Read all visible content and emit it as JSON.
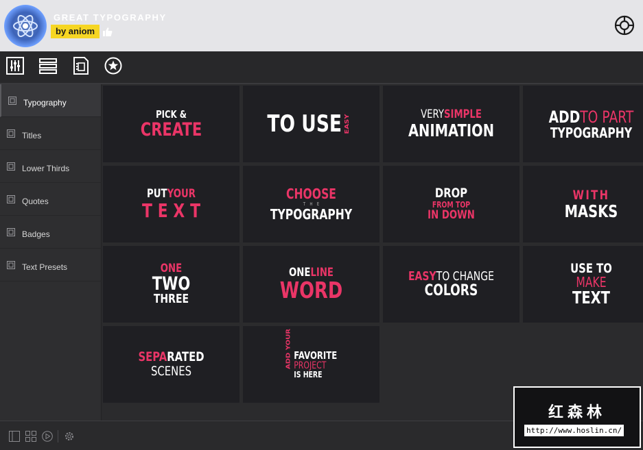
{
  "header": {
    "title": "GREAT TYPOGRAPHY",
    "author": "by aniom",
    "logo_icon": "atom-logo-icon",
    "like_icon": "thumbs-up-icon",
    "help_icon": "lifebuoy-icon"
  },
  "toolbar": {
    "buttons": [
      "sliders-icon",
      "list-icon",
      "film-icon",
      "star-icon"
    ]
  },
  "sidebar": {
    "items": [
      {
        "label": "Typography",
        "active": true
      },
      {
        "label": "Titles"
      },
      {
        "label": "Lower Thirds"
      },
      {
        "label": "Quotes"
      },
      {
        "label": "Badges"
      },
      {
        "label": "Text Presets"
      }
    ]
  },
  "tiles": [
    {
      "l1": "PICK &",
      "l2": "CREATE"
    },
    {
      "l1": "TO USE",
      "l2": "EASY"
    },
    {
      "l1a": "VERY",
      "l1b": "SIMPLE",
      "l2": "ANIMATION"
    },
    {
      "l1a": "ADD",
      "l1b": "TO PART",
      "l2": "TYPOGRAPHY"
    },
    {
      "l1a": "PUT",
      "l1b": "YOUR",
      "l2": "TEXT"
    },
    {
      "l1": "CHOOSE",
      "l2": "THE",
      "l3": "TYPOGRAPHY"
    },
    {
      "l1": "DROP",
      "l2": "FROM TOP",
      "l3": "IN DOWN"
    },
    {
      "l1": "WITH",
      "l2": "MASKS"
    },
    {
      "l1": "ONE",
      "l2": "TWO",
      "l3": "THREE"
    },
    {
      "l1a": "ONE",
      "l1b": "LINE",
      "l2": "WORD"
    },
    {
      "l1a": "EASY",
      "l1b": "TO CHANGE",
      "l2": "COLORS"
    },
    {
      "l1": "USE TO",
      "l2": "MAKE",
      "l3": "TEXT"
    },
    {
      "l1a": "SEPA",
      "l1b": "RATED",
      "l2": "SCENES"
    },
    {
      "side": "ADD YOUR",
      "l1": "FAVORITE",
      "l2": "PROJECT",
      "l3": "IS HERE"
    }
  ],
  "bottombar": {
    "icons": [
      "panel-icon",
      "grid-icon",
      "play-icon",
      "settings-icon"
    ]
  },
  "watermark": {
    "title": "红森林",
    "url": "http://www.hoslin.cn/"
  },
  "colors": {
    "accent_pink": "#ea3567",
    "badge_yellow": "#f6d623",
    "tile_bg": "#1f1f23"
  }
}
